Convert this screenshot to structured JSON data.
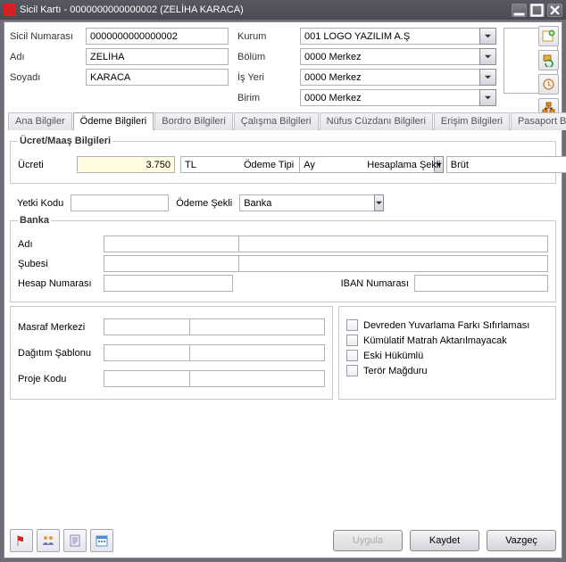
{
  "window": {
    "title": "Sicil Kartı - 0000000000000002 (ZELİHA KARACA)"
  },
  "header": {
    "sicil_no_label": "Sicil Numarası",
    "sicil_no": "0000000000000002",
    "adi_label": "Adı",
    "adi": "ZELİHA",
    "soyadi_label": "Soyadı",
    "soyadi": "KARACA",
    "kurum_label": "Kurum",
    "kurum": "001 LOGO YAZILIM A.Ş",
    "bolum_label": "Bölüm",
    "bolum": "0000 Merkez",
    "isyeri_label": "İş Yeri",
    "isyeri": "0000 Merkez",
    "birim_label": "Birim",
    "birim": "0000 Merkez"
  },
  "tabs": {
    "ana": "Ana Bilgiler",
    "odeme": "Ödeme Bilgileri",
    "bordro": "Bordro Bilgileri",
    "calisma": "Çalışma Bilgileri",
    "nufus": "Nüfus Cüzdanı Bilgileri",
    "erisim": "Erişim Bilgileri",
    "pasaport": "Pasaport Bilgileri"
  },
  "ucret": {
    "legend": "Ücret/Maaş Bilgileri",
    "ucreti_label": "Ücreti",
    "ucreti": "3.750",
    "para_birimi": "TL",
    "odeme_tipi_label": "Ödeme Tipi",
    "odeme_tipi": "Ay",
    "hesaplama_label": "Hesaplama Şekli",
    "hesaplama": "Brüt"
  },
  "yetki": {
    "kodu_label": "Yetki Kodu",
    "kodu": "",
    "odeme_sekli_label": "Ödeme Şekli",
    "odeme_sekli": "Banka"
  },
  "banka": {
    "legend": "Banka",
    "adi_label": "Adı",
    "adi_code": "",
    "adi_desc": "",
    "subesi_label": "Şubesi",
    "subesi_code": "",
    "subesi_desc": "",
    "hesap_label": "Hesap Numarası",
    "hesap_no": "",
    "iban_label": "IBAN Numarası",
    "iban_no": ""
  },
  "masraf": {
    "masraf_label": "Masraf Merkezi",
    "masraf_code": "",
    "masraf_desc": "",
    "dagitim_label": "Dağıtım Şablonu",
    "dagitim_code": "",
    "dagitim_desc": "",
    "proje_label": "Proje Kodu",
    "proje_code": "",
    "proje_desc": ""
  },
  "flags": {
    "devreden": "Devreden Yuvarlama Farkı Sıfırlaması",
    "kumulatif": "Kümülatif Matrah Aktarılmayacak",
    "eski": "Eski Hükümlü",
    "teror": "Terör Mağduru"
  },
  "buttons": {
    "uygula": "Uygula",
    "kaydet": "Kaydet",
    "vazgec": "Vazgeç"
  }
}
